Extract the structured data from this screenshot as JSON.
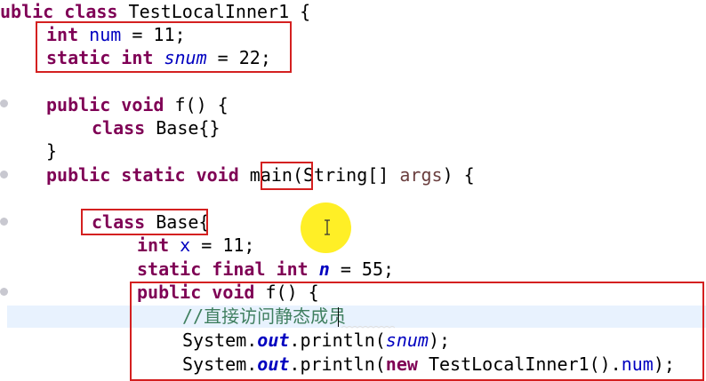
{
  "editor": {
    "lines": [
      {
        "tokens": [
          {
            "t": "ublic",
            "c": "kw"
          },
          {
            "t": " ",
            "c": ""
          },
          {
            "t": "class",
            "c": "kw"
          },
          {
            "t": " TestLocalInner1 {",
            "c": ""
          }
        ]
      },
      {
        "tokens": [
          {
            "t": "int",
            "c": "kw"
          },
          {
            "t": " ",
            "c": ""
          },
          {
            "t": "num",
            "c": "field"
          },
          {
            "t": " = 11;",
            "c": ""
          }
        ]
      },
      {
        "tokens": [
          {
            "t": "static",
            "c": "kw"
          },
          {
            "t": " ",
            "c": ""
          },
          {
            "t": "int",
            "c": "kw"
          },
          {
            "t": " ",
            "c": ""
          },
          {
            "t": "snum",
            "c": "sfield"
          },
          {
            "t": " = 22;",
            "c": ""
          }
        ]
      },
      {
        "tokens": []
      },
      {
        "tokens": [
          {
            "t": "public",
            "c": "kw"
          },
          {
            "t": " ",
            "c": ""
          },
          {
            "t": "void",
            "c": "kw"
          },
          {
            "t": " f() {",
            "c": ""
          }
        ]
      },
      {
        "tokens": [
          {
            "t": "class",
            "c": "kw"
          },
          {
            "t": " Base{}",
            "c": ""
          }
        ]
      },
      {
        "tokens": [
          {
            "t": "}",
            "c": ""
          }
        ]
      },
      {
        "tokens": [
          {
            "t": "public",
            "c": "kw"
          },
          {
            "t": " ",
            "c": ""
          },
          {
            "t": "static",
            "c": "kw"
          },
          {
            "t": " ",
            "c": ""
          },
          {
            "t": "void",
            "c": "kw"
          },
          {
            "t": " main(String[] ",
            "c": ""
          },
          {
            "t": "args",
            "c": "param"
          },
          {
            "t": ") {",
            "c": ""
          }
        ]
      },
      {
        "tokens": []
      },
      {
        "tokens": [
          {
            "t": "class",
            "c": "kw"
          },
          {
            "t": " Base{",
            "c": ""
          }
        ]
      },
      {
        "tokens": [
          {
            "t": "int",
            "c": "kw"
          },
          {
            "t": " ",
            "c": ""
          },
          {
            "t": "x",
            "c": "field"
          },
          {
            "t": " = 11;",
            "c": ""
          }
        ]
      },
      {
        "tokens": [
          {
            "t": "static",
            "c": "kw"
          },
          {
            "t": " ",
            "c": ""
          },
          {
            "t": "final",
            "c": "kw"
          },
          {
            "t": " ",
            "c": ""
          },
          {
            "t": "int",
            "c": "kw"
          },
          {
            "t": " ",
            "c": ""
          },
          {
            "t": "n",
            "c": "sfinal"
          },
          {
            "t": " = 55;",
            "c": ""
          }
        ]
      },
      {
        "tokens": [
          {
            "t": "public",
            "c": "kw"
          },
          {
            "t": " ",
            "c": ""
          },
          {
            "t": "void",
            "c": "kw"
          },
          {
            "t": " f() {",
            "c": ""
          }
        ]
      },
      {
        "tokens": [
          {
            "t": "//直接访问静态成员",
            "c": "cmt"
          }
        ]
      },
      {
        "tokens": [
          {
            "t": "System.",
            "c": ""
          },
          {
            "t": "out",
            "c": "sfinal"
          },
          {
            "t": ".println(",
            "c": ""
          },
          {
            "t": "snum",
            "c": "sfield"
          },
          {
            "t": ");",
            "c": ""
          }
        ]
      },
      {
        "tokens": [
          {
            "t": "System.",
            "c": ""
          },
          {
            "t": "out",
            "c": "sfinal"
          },
          {
            "t": ".println(",
            "c": ""
          },
          {
            "t": "new",
            "c": "kw"
          },
          {
            "t": " TestLocalInner1().",
            "c": ""
          },
          {
            "t": "num",
            "c": "field"
          },
          {
            "t": ");",
            "c": ""
          }
        ]
      }
    ]
  },
  "colors": {
    "keyword": "#7f0055",
    "field": "#0000c0",
    "comment": "#3f7f5f",
    "annotation_box": "#d42020",
    "cursor_highlight": "#ffee14",
    "current_line": "#e8f2fe"
  }
}
